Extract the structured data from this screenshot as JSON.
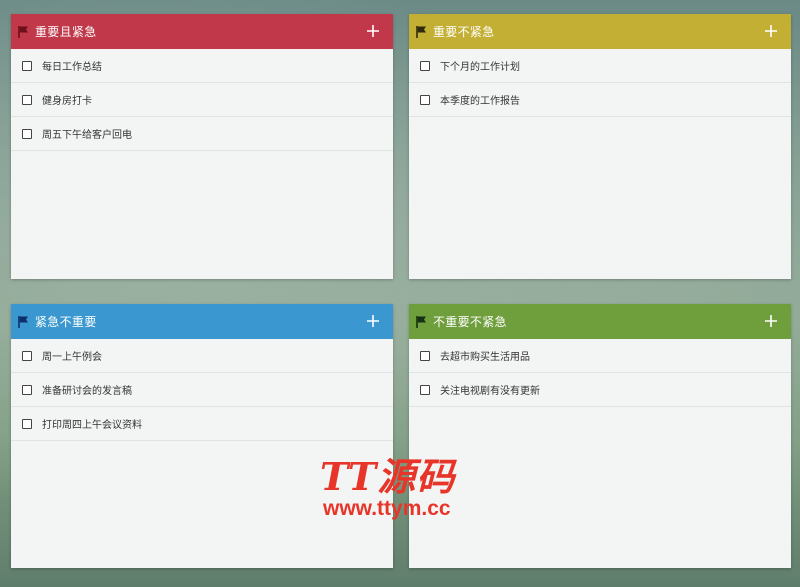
{
  "colors": {
    "important_urgent": "#c0384a",
    "important_not_urgent": "#c3af33",
    "urgent_not_important": "#3a97cf",
    "not_important_not_urgent": "#6f9e3c",
    "watermark": "#e8352a"
  },
  "panels": [
    {
      "title": "重要且紧急",
      "flag_icon": "flag-icon",
      "add_icon": "plus-icon",
      "tasks": [
        "每日工作总结",
        "健身房打卡",
        "周五下午给客户回电"
      ]
    },
    {
      "title": "重要不紧急",
      "flag_icon": "flag-icon",
      "add_icon": "plus-icon",
      "tasks": [
        "下个月的工作计划",
        "本季度的工作报告"
      ]
    },
    {
      "title": "紧急不重要",
      "flag_icon": "flag-icon",
      "add_icon": "plus-icon",
      "tasks": [
        "周一上午例会",
        "准备研讨会的发言稿",
        "打印周四上午会议资料"
      ]
    },
    {
      "title": "不重要不紧急",
      "flag_icon": "flag-icon",
      "add_icon": "plus-icon",
      "tasks": [
        "去超市购买生活用品",
        "关注电视剧有没有更新"
      ]
    }
  ],
  "watermark": {
    "logo": "TT源码",
    "url": "www.ttym.cc"
  }
}
